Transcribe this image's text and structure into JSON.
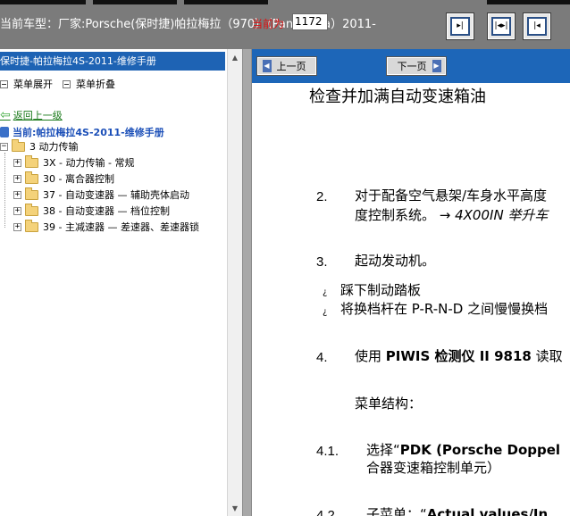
{
  "header": {
    "car_title": "当前车型：厂家:Porsche(保时捷)帕拉梅拉（970）（Panamera）2011-",
    "icon_buttons": [
      {
        "name": "dock-left-icon",
        "glyph": "▸|"
      },
      {
        "name": "split-panes-icon",
        "glyph": "|◂▸|"
      },
      {
        "name": "dock-right-icon",
        "glyph": "|◂"
      }
    ]
  },
  "left_panel": {
    "title": "保时捷-帕拉梅拉4S-2011-维修手册",
    "expand_menu": "菜单展开",
    "collapse_menu": "菜单折叠",
    "back_link": "返回上一级",
    "current": "当前:帕拉梅拉4S-2011-维修手册",
    "root_node": "3 动力传输",
    "tree_items": [
      "3X - 动力传输 - 常规",
      "30 - 离合器控制",
      "37 - 自动变速器 — 辅助壳体启动",
      "38 - 自动变速器 — 档位控制",
      "39 - 主减速器 — 差速器、差速器锁"
    ]
  },
  "right_panel": {
    "prev_page": "上一页",
    "next_page": "下一页",
    "current_page_label": "当前为",
    "current_page_value": "1172",
    "doc_title": "检查并加满自动变速箱油",
    "steps": [
      {
        "num": "2.",
        "line1": "对于配备空气悬架/车身水平高度",
        "line2_a": "度控制系统。 → ",
        "line2_b": "4X00IN 举升车"
      },
      {
        "num": "3.",
        "line1": "起动发动机。"
      },
      {
        "bullet": "¿",
        "text": "踩下制动踏板"
      },
      {
        "bullet": "¿",
        "text": "将换档杆在 P-R-N-D 之间慢慢换档"
      },
      {
        "num": "4.",
        "prefix": "使用 ",
        "bold": "PIWIS 检测仪 II 9818",
        "suffix": " 读取"
      },
      {
        "text": "菜单结构："
      },
      {
        "num": "4.1.",
        "prefix": "选择“",
        "bold": "PDK (Porsche Doppel",
        "line2": "合器变速箱控制单元）"
      },
      {
        "num": "4.2.",
        "prefix": "子菜单：“",
        "bold": "Actual values/In"
      }
    ]
  },
  "colors": {
    "header_bg": "#7b7b7b",
    "panel_title_bg": "#1e63b4",
    "nav_bar_bg": "#1d66b8",
    "current_label_red": "#e01010",
    "link_green": "#1a7a1a",
    "current_blue": "#1b4fb8"
  }
}
